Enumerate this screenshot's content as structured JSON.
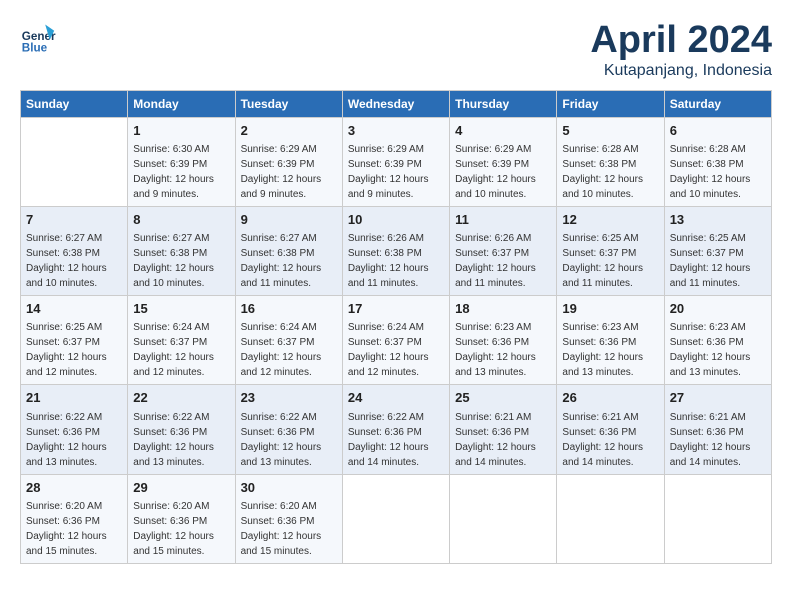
{
  "header": {
    "logo_line1": "General",
    "logo_line2": "Blue",
    "month": "April 2024",
    "location": "Kutapanjang, Indonesia"
  },
  "weekdays": [
    "Sunday",
    "Monday",
    "Tuesday",
    "Wednesday",
    "Thursday",
    "Friday",
    "Saturday"
  ],
  "weeks": [
    [
      {
        "day": "",
        "sunrise": "",
        "sunset": "",
        "daylight": ""
      },
      {
        "day": "1",
        "sunrise": "Sunrise: 6:30 AM",
        "sunset": "Sunset: 6:39 PM",
        "daylight": "Daylight: 12 hours and 9 minutes."
      },
      {
        "day": "2",
        "sunrise": "Sunrise: 6:29 AM",
        "sunset": "Sunset: 6:39 PM",
        "daylight": "Daylight: 12 hours and 9 minutes."
      },
      {
        "day": "3",
        "sunrise": "Sunrise: 6:29 AM",
        "sunset": "Sunset: 6:39 PM",
        "daylight": "Daylight: 12 hours and 9 minutes."
      },
      {
        "day": "4",
        "sunrise": "Sunrise: 6:29 AM",
        "sunset": "Sunset: 6:39 PM",
        "daylight": "Daylight: 12 hours and 10 minutes."
      },
      {
        "day": "5",
        "sunrise": "Sunrise: 6:28 AM",
        "sunset": "Sunset: 6:38 PM",
        "daylight": "Daylight: 12 hours and 10 minutes."
      },
      {
        "day": "6",
        "sunrise": "Sunrise: 6:28 AM",
        "sunset": "Sunset: 6:38 PM",
        "daylight": "Daylight: 12 hours and 10 minutes."
      }
    ],
    [
      {
        "day": "7",
        "sunrise": "Sunrise: 6:27 AM",
        "sunset": "Sunset: 6:38 PM",
        "daylight": "Daylight: 12 hours and 10 minutes."
      },
      {
        "day": "8",
        "sunrise": "Sunrise: 6:27 AM",
        "sunset": "Sunset: 6:38 PM",
        "daylight": "Daylight: 12 hours and 10 minutes."
      },
      {
        "day": "9",
        "sunrise": "Sunrise: 6:27 AM",
        "sunset": "Sunset: 6:38 PM",
        "daylight": "Daylight: 12 hours and 11 minutes."
      },
      {
        "day": "10",
        "sunrise": "Sunrise: 6:26 AM",
        "sunset": "Sunset: 6:38 PM",
        "daylight": "Daylight: 12 hours and 11 minutes."
      },
      {
        "day": "11",
        "sunrise": "Sunrise: 6:26 AM",
        "sunset": "Sunset: 6:37 PM",
        "daylight": "Daylight: 12 hours and 11 minutes."
      },
      {
        "day": "12",
        "sunrise": "Sunrise: 6:25 AM",
        "sunset": "Sunset: 6:37 PM",
        "daylight": "Daylight: 12 hours and 11 minutes."
      },
      {
        "day": "13",
        "sunrise": "Sunrise: 6:25 AM",
        "sunset": "Sunset: 6:37 PM",
        "daylight": "Daylight: 12 hours and 11 minutes."
      }
    ],
    [
      {
        "day": "14",
        "sunrise": "Sunrise: 6:25 AM",
        "sunset": "Sunset: 6:37 PM",
        "daylight": "Daylight: 12 hours and 12 minutes."
      },
      {
        "day": "15",
        "sunrise": "Sunrise: 6:24 AM",
        "sunset": "Sunset: 6:37 PM",
        "daylight": "Daylight: 12 hours and 12 minutes."
      },
      {
        "day": "16",
        "sunrise": "Sunrise: 6:24 AM",
        "sunset": "Sunset: 6:37 PM",
        "daylight": "Daylight: 12 hours and 12 minutes."
      },
      {
        "day": "17",
        "sunrise": "Sunrise: 6:24 AM",
        "sunset": "Sunset: 6:37 PM",
        "daylight": "Daylight: 12 hours and 12 minutes."
      },
      {
        "day": "18",
        "sunrise": "Sunrise: 6:23 AM",
        "sunset": "Sunset: 6:36 PM",
        "daylight": "Daylight: 12 hours and 13 minutes."
      },
      {
        "day": "19",
        "sunrise": "Sunrise: 6:23 AM",
        "sunset": "Sunset: 6:36 PM",
        "daylight": "Daylight: 12 hours and 13 minutes."
      },
      {
        "day": "20",
        "sunrise": "Sunrise: 6:23 AM",
        "sunset": "Sunset: 6:36 PM",
        "daylight": "Daylight: 12 hours and 13 minutes."
      }
    ],
    [
      {
        "day": "21",
        "sunrise": "Sunrise: 6:22 AM",
        "sunset": "Sunset: 6:36 PM",
        "daylight": "Daylight: 12 hours and 13 minutes."
      },
      {
        "day": "22",
        "sunrise": "Sunrise: 6:22 AM",
        "sunset": "Sunset: 6:36 PM",
        "daylight": "Daylight: 12 hours and 13 minutes."
      },
      {
        "day": "23",
        "sunrise": "Sunrise: 6:22 AM",
        "sunset": "Sunset: 6:36 PM",
        "daylight": "Daylight: 12 hours and 13 minutes."
      },
      {
        "day": "24",
        "sunrise": "Sunrise: 6:22 AM",
        "sunset": "Sunset: 6:36 PM",
        "daylight": "Daylight: 12 hours and 14 minutes."
      },
      {
        "day": "25",
        "sunrise": "Sunrise: 6:21 AM",
        "sunset": "Sunset: 6:36 PM",
        "daylight": "Daylight: 12 hours and 14 minutes."
      },
      {
        "day": "26",
        "sunrise": "Sunrise: 6:21 AM",
        "sunset": "Sunset: 6:36 PM",
        "daylight": "Daylight: 12 hours and 14 minutes."
      },
      {
        "day": "27",
        "sunrise": "Sunrise: 6:21 AM",
        "sunset": "Sunset: 6:36 PM",
        "daylight": "Daylight: 12 hours and 14 minutes."
      }
    ],
    [
      {
        "day": "28",
        "sunrise": "Sunrise: 6:20 AM",
        "sunset": "Sunset: 6:36 PM",
        "daylight": "Daylight: 12 hours and 15 minutes."
      },
      {
        "day": "29",
        "sunrise": "Sunrise: 6:20 AM",
        "sunset": "Sunset: 6:36 PM",
        "daylight": "Daylight: 12 hours and 15 minutes."
      },
      {
        "day": "30",
        "sunrise": "Sunrise: 6:20 AM",
        "sunset": "Sunset: 6:36 PM",
        "daylight": "Daylight: 12 hours and 15 minutes."
      },
      {
        "day": "",
        "sunrise": "",
        "sunset": "",
        "daylight": ""
      },
      {
        "day": "",
        "sunrise": "",
        "sunset": "",
        "daylight": ""
      },
      {
        "day": "",
        "sunrise": "",
        "sunset": "",
        "daylight": ""
      },
      {
        "day": "",
        "sunrise": "",
        "sunset": "",
        "daylight": ""
      }
    ]
  ]
}
